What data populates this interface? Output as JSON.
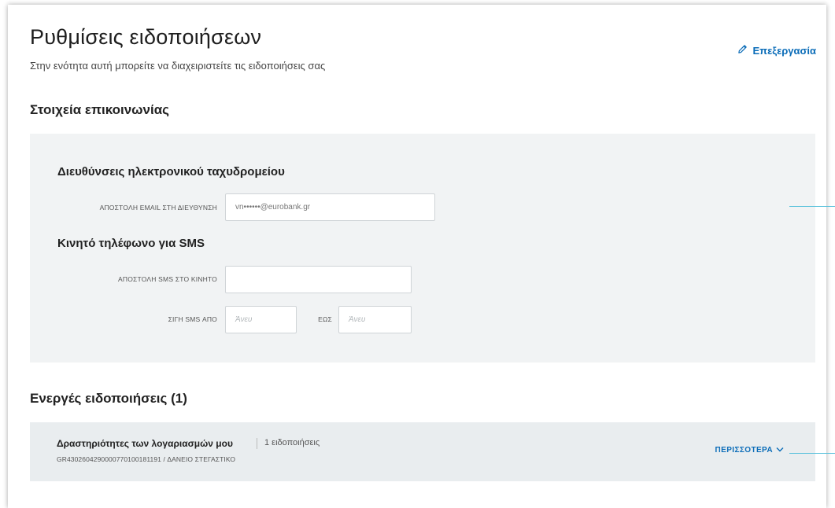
{
  "header": {
    "title": "Ρυθμίσεις ειδοποιήσεων",
    "subtitle": "Στην ενότητα αυτή μπορείτε να διαχειριστείτε τις ειδοποιήσεις σας",
    "edit_label": "Επεξεργασία"
  },
  "contact": {
    "section_title": "Στοιχεία επικοινωνίας",
    "email": {
      "title": "Διευθύνσεις ηλεκτρονικού ταχυδρομείου",
      "label": "ΑΠΟΣΤΟΛΗ EMAIL ΣΤΗ ΔΙΕΥΘΥΝΣΗ",
      "value": "vn••••••@eurobank.gr"
    },
    "sms": {
      "title": "Κινητό τηλέφωνο για SMS",
      "label": "ΑΠΟΣΤΟΛΗ SMS ΣΤΟ ΚΙΝΗΤΟ",
      "value": "",
      "silence_from_label": "ΣΙΓΗ SMS ΑΠΟ",
      "silence_from_placeholder": "Άνευ",
      "silence_to_label": "ΕΩΣ",
      "silence_to_placeholder": "Άνευ"
    }
  },
  "alerts": {
    "section_title": "Ενεργές ειδοποιήσεις (1)",
    "items": [
      {
        "title": "Δραστηριότητες των λογαριασμών μου",
        "count": "1 ειδοποιήσεις",
        "account": "GR4302604290000770100181191 / ΔΑΝΕΙΟ ΣΤΕΓΑΣΤΙΚΟ",
        "more_label": "ΠΕΡΙΣΣΟΤΕΡΑ"
      }
    ]
  },
  "colors": {
    "accent": "#0a6cb8",
    "panel": "#f1f3f4",
    "alert_row": "#e9edef",
    "indicator_line": "#5bc2dc"
  },
  "icons": {
    "edit": "pencil-icon",
    "more": "chevron-down-icon"
  }
}
